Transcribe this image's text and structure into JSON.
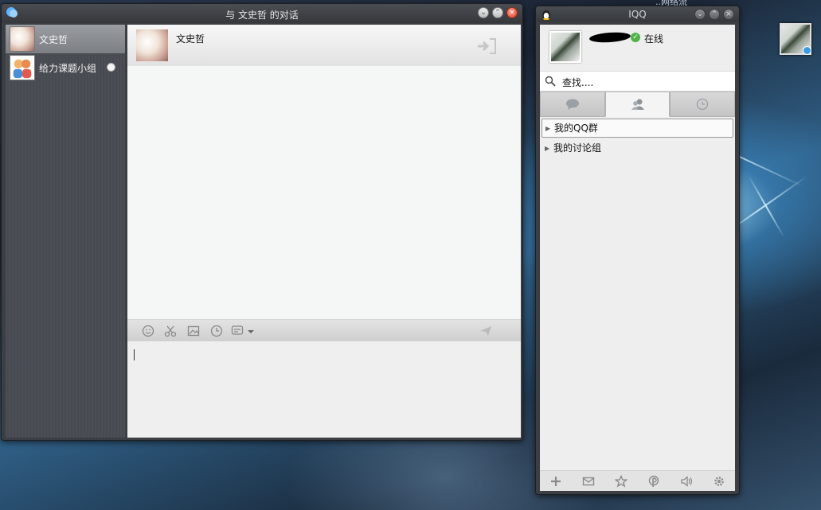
{
  "desktop": {
    "top_label": "..网络流"
  },
  "chat_window": {
    "title": "与 文史哲 的对话",
    "sessions": [
      {
        "name": "文史哲",
        "active": true
      },
      {
        "name": "给力课题小组",
        "active": false
      }
    ],
    "header": {
      "contact_name": "文史哲"
    },
    "toolbar_icons": [
      "smiley-icon",
      "scissors-icon",
      "image-icon",
      "clock-icon",
      "message-style-icon",
      "send-icon"
    ],
    "input_value": ""
  },
  "qq_window": {
    "title": "IQQ",
    "profile": {
      "status_text": "在线"
    },
    "search": {
      "text": "查找...."
    },
    "tabs": [
      {
        "icon": "chat-bubble-icon",
        "active": false
      },
      {
        "icon": "contacts-icon",
        "active": true
      },
      {
        "icon": "recent-clock-icon",
        "active": false
      }
    ],
    "groups": [
      {
        "label": "我的QQ群",
        "selected": true
      },
      {
        "label": "我的讨论组",
        "selected": false
      }
    ],
    "bottom_icons": [
      "add-icon",
      "mail-icon",
      "star-icon",
      "pin-icon",
      "volume-icon",
      "settings-icon"
    ]
  }
}
